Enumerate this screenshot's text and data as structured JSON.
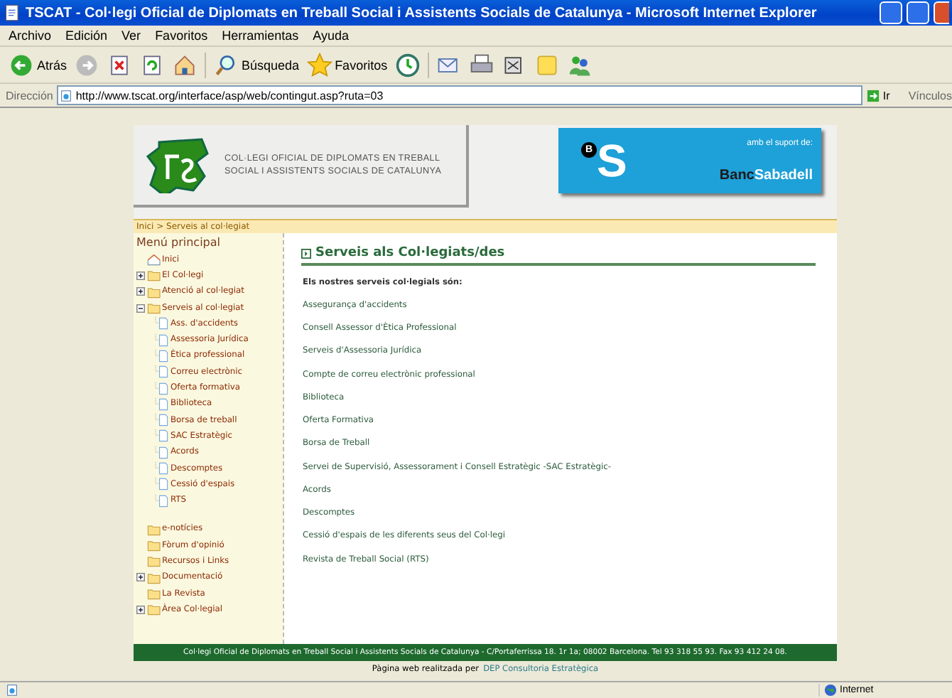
{
  "window": {
    "title": "TSCAT - Col·legi Oficial de Diplomats en Treball Social i Assistents Socials de Catalunya - Microsoft Internet Explorer"
  },
  "menu_bar": [
    "Archivo",
    "Edición",
    "Ver",
    "Favoritos",
    "Herramientas",
    "Ayuda"
  ],
  "toolbar": [
    {
      "kind": "back",
      "label": "Atrás"
    },
    {
      "kind": "forward"
    },
    {
      "kind": "stop"
    },
    {
      "kind": "refresh"
    },
    {
      "kind": "home"
    },
    {
      "kind": "search",
      "label": "Búsqueda"
    },
    {
      "kind": "favorites",
      "label": "Favoritos"
    },
    {
      "kind": "history"
    },
    {
      "kind": "mail"
    },
    {
      "kind": "print"
    },
    {
      "kind": "edit"
    },
    {
      "kind": "note"
    },
    {
      "kind": "messenger"
    }
  ],
  "address_bar": {
    "label": "Dirección",
    "value": "http://www.tscat.org/interface/asp/web/contingut.asp?ruta=03",
    "go": "Ir",
    "links": "Vínculos"
  },
  "header": {
    "logo_lines": [
      "COL·LEGI OFICIAL DE DIPLOMATS EN TREBALL",
      "SOCIAL I ASSISTENTS SOCIALS DE CATALUNYA"
    ],
    "sponsor": {
      "caption": "amb el suport de:",
      "mark_letters": [
        "B",
        "S"
      ],
      "name": "**Banc**Sabadell"
    }
  },
  "breadcrumb": "Inici > Serveis al col·legiat",
  "sidebar": {
    "title": "Menú principal",
    "sections": [
      [
        {
          "kind": "home",
          "label": "Inici"
        },
        {
          "kind": "folder",
          "label": "El Col·legi",
          "expanded": false
        },
        {
          "kind": "folder",
          "label": "Atenció al col·legiat",
          "expanded": false
        },
        {
          "kind": "folder",
          "label": "Serveis al col·legiat",
          "expanded": true,
          "children": [
            {
              "kind": "page",
              "label": "Ass. d'accidents"
            },
            {
              "kind": "page",
              "label": "Assessoria Jurídica"
            },
            {
              "kind": "page",
              "label": "Ètica professional"
            },
            {
              "kind": "page",
              "label": "Correu electrònic"
            },
            {
              "kind": "page",
              "label": "Oferta formativa"
            },
            {
              "kind": "page",
              "label": "Biblioteca"
            },
            {
              "kind": "page",
              "label": "Borsa de treball"
            },
            {
              "kind": "page",
              "label": "SAC Estratègic"
            },
            {
              "kind": "page",
              "label": "Acords"
            },
            {
              "kind": "page",
              "label": "Descomptes"
            },
            {
              "kind": "page",
              "label": "Cessió d'espais"
            },
            {
              "kind": "page",
              "label": "RTS"
            }
          ]
        }
      ],
      [
        {
          "kind": "folder",
          "label": "e-notícies"
        },
        {
          "kind": "folder",
          "label": "Fòrum d'opinió"
        },
        {
          "kind": "folder",
          "label": "Recursos i Links"
        },
        {
          "kind": "folder",
          "label": "Documentació",
          "expanded": false
        },
        {
          "kind": "folder",
          "label": "La Revista"
        },
        {
          "kind": "folder",
          "label": "Àrea Col·legial",
          "expanded": false
        }
      ]
    ]
  },
  "main": {
    "heading": "Serveis als Col·legiats/des",
    "intro": "Els nostres serveis col·legials són:",
    "groups": [
      [
        "Assegurança d'accidents",
        "Consell Assessor d'Ètica Professional",
        "Serveis d'Assessoria Jurídica",
        "Compte de correu electrònic professional",
        "Biblioteca",
        "Oferta Formativa",
        "Borsa de Treball"
      ],
      [
        "Servei de Supervisió, Assessorament i Consell Estratègic -SAC Estratègic-",
        "Acords",
        "Descomptes",
        "Cessió d'espais de les diferents seus del Col·legi"
      ],
      [
        "Revista de Treball Social (RTS)"
      ]
    ]
  },
  "footer": {
    "address": "Col·legi Oficial de Diplomats en Treball Social i Assistents Socials de Catalunya - C/Portaferrissa 18. 1r 1a; 08002 Barcelona. Tel 93 318 55 93. Fax 93 412 24 08.",
    "credit": "Pàgina web realitzada per",
    "credit_link": "DEP Consultoria Estratègica"
  },
  "status_bar": {
    "zone": "Internet"
  }
}
